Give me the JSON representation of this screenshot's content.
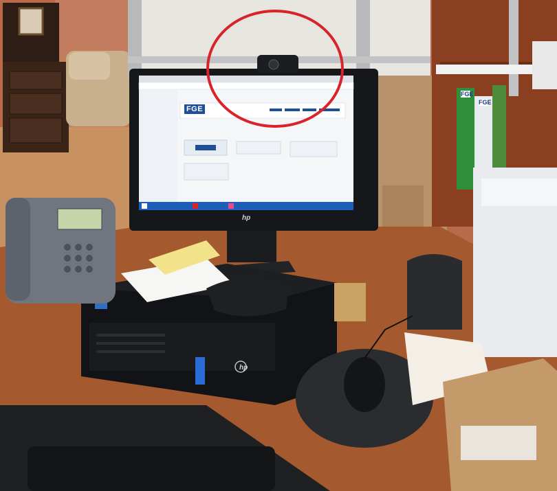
{
  "screen_logo": "FGE",
  "binder_labels": [
    "FGE",
    "FGE"
  ],
  "brand_marks": [
    "hp",
    "hp"
  ],
  "colors": {
    "webcam_circle": "#d9232a",
    "desk": "#a45a2e",
    "monitor_bezel": "#15171b",
    "screen_bg": "#f4f6f8",
    "taskbar": "#1d5fb8",
    "phone": "#6f7680",
    "mousepad": "#2b2c2f"
  }
}
